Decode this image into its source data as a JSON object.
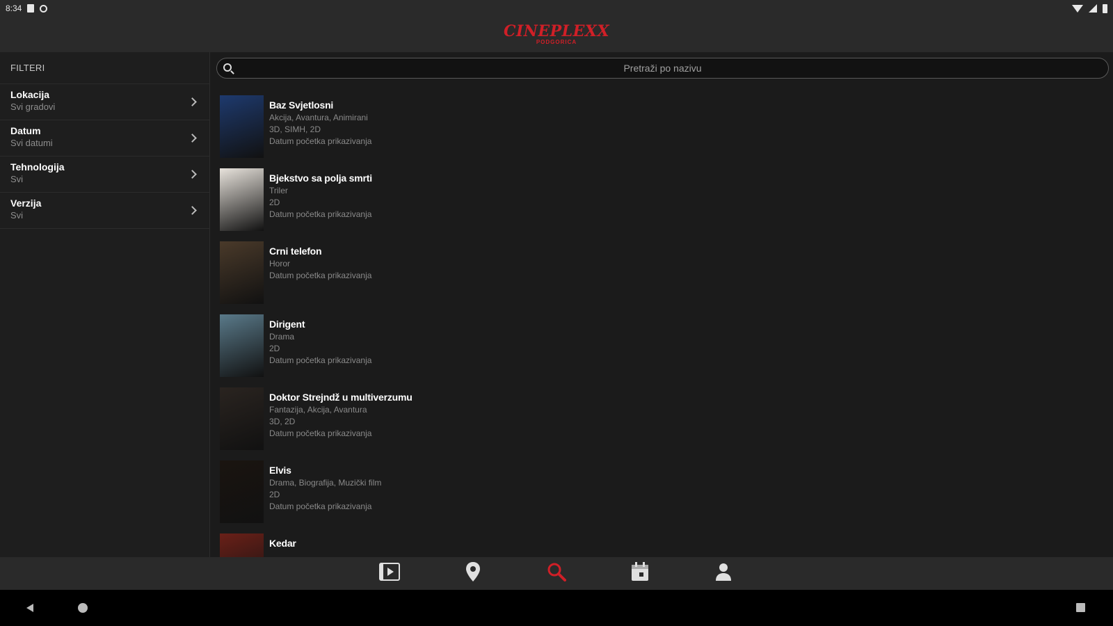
{
  "status_bar": {
    "time": "8:34"
  },
  "app": {
    "logo_main": "CINEPLEXX",
    "logo_sub": "PODGORICA",
    "brand_color": "#d01f27"
  },
  "sidebar": {
    "title": "FILTERI",
    "filters": [
      {
        "label": "Lokacija",
        "value": "Svi gradovi"
      },
      {
        "label": "Datum",
        "value": "Svi datumi"
      },
      {
        "label": "Tehnologija",
        "value": "Svi"
      },
      {
        "label": "Verzija",
        "value": "Svi"
      }
    ]
  },
  "search": {
    "placeholder": "Pretraži po nazivu",
    "icon": "search-icon"
  },
  "movies": [
    {
      "title": "Baz Svjetlosni",
      "genre": "Akcija, Avantura, Animirani",
      "tech": "3D, SIMH, 2D",
      "release": "Datum početka prikazivanja",
      "poster_color": "#1e3a6e"
    },
    {
      "title": "Bjekstvo sa polja smrti",
      "genre": "Triler",
      "tech": "2D",
      "release": "Datum početka prikazivanja",
      "poster_color": "#e8e3dc"
    },
    {
      "title": "Crni telefon",
      "genre": "Horor",
      "tech": "",
      "release": "Datum početka prikazivanja",
      "poster_color": "#4a3a2a"
    },
    {
      "title": "Dirigent",
      "genre": "Drama",
      "tech": "2D",
      "release": "Datum početka prikazivanja",
      "poster_color": "#5a7a8a"
    },
    {
      "title": "Doktor Strejndž u multiverzumu",
      "genre": "Fantazija, Akcija, Avantura",
      "tech": "3D, 2D",
      "release": "Datum početka prikazivanja",
      "poster_color": "#2a2420"
    },
    {
      "title": "Elvis",
      "genre": "Drama, Biografija, Muzički film",
      "tech": "2D",
      "release": "Datum početka prikazivanja",
      "poster_color": "#1a1410"
    },
    {
      "title": "Kedar",
      "genre": "",
      "tech": "",
      "release": "",
      "poster_color": "#6a2018"
    }
  ],
  "bottom_nav": [
    {
      "name": "movies-nav",
      "icon": "film-icon",
      "active": false
    },
    {
      "name": "location-nav",
      "icon": "location-pin-icon",
      "active": false
    },
    {
      "name": "search-nav",
      "icon": "search-icon",
      "active": true
    },
    {
      "name": "calendar-nav",
      "icon": "calendar-icon",
      "active": false
    },
    {
      "name": "profile-nav",
      "icon": "user-icon",
      "active": false
    }
  ]
}
